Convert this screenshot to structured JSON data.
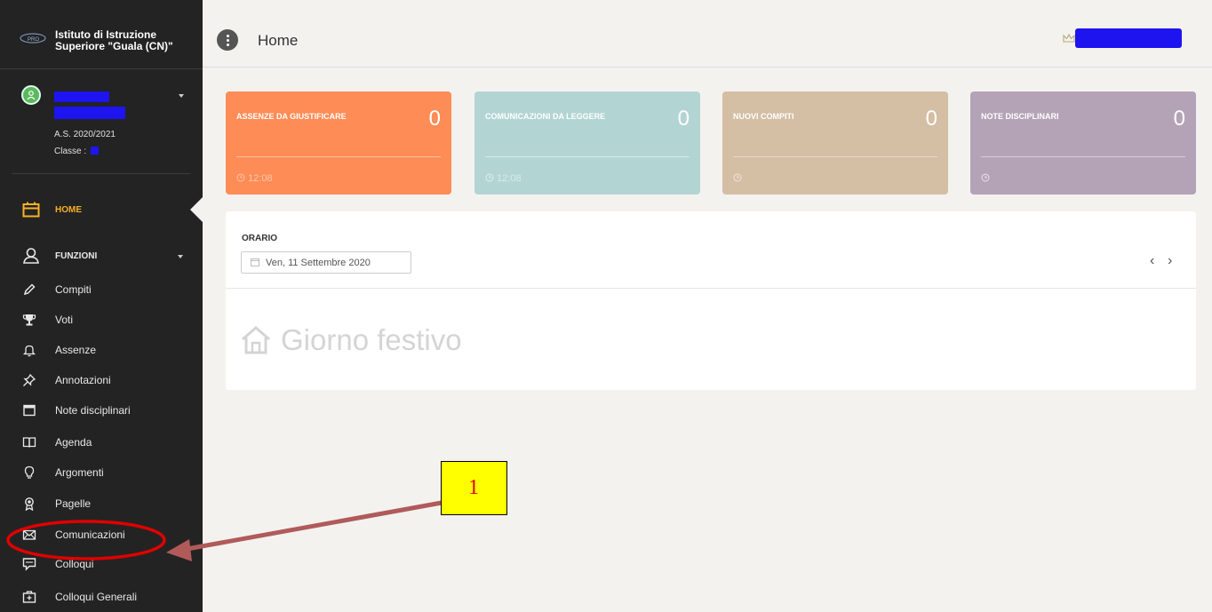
{
  "school": {
    "name": "Istituto di Istruzione Superiore \"Guala (CN)\"",
    "logo_icon": "school-logo-icon"
  },
  "user": {
    "school_year": "A.S. 2020/2021",
    "class_label": "Classe :",
    "avatar_icon": "user-avatar-icon"
  },
  "sidebar": {
    "home": {
      "label": "HOME",
      "icon": "calendar-icon",
      "active_color": "#f6b026"
    },
    "functions": {
      "label": "FUNZIONI",
      "icon": "person-icon"
    },
    "items": [
      {
        "label": "Compiti",
        "icon": "pencil-icon"
      },
      {
        "label": "Voti",
        "icon": "trophy-icon"
      },
      {
        "label": "Assenze",
        "icon": "bell-icon"
      },
      {
        "label": "Annotazioni",
        "icon": "pin-icon"
      },
      {
        "label": "Note disciplinari",
        "icon": "window-icon"
      },
      {
        "label": "Agenda",
        "icon": "book-icon"
      },
      {
        "label": "Argomenti",
        "icon": "lightbulb-icon"
      },
      {
        "label": "Pagelle",
        "icon": "award-icon"
      },
      {
        "label": "Comunicazioni",
        "icon": "envelope-icon"
      },
      {
        "label": "Colloqui",
        "icon": "chat-icon"
      },
      {
        "label": "Colloqui Generali",
        "icon": "briefcase-icon"
      }
    ]
  },
  "header": {
    "title": "Home",
    "crown_icon": "crown-icon"
  },
  "cards": [
    {
      "title": "ASSENZE DA GIUSTIFICARE",
      "count": "0",
      "time": "12:08",
      "color": "#fe8c56"
    },
    {
      "title": "COMUNICAZIONI DA LEGGERE",
      "count": "0",
      "time": "12:08",
      "color": "#b2d5d3"
    },
    {
      "title": "NUOVI COMPITI",
      "count": "0",
      "time": "",
      "color": "#d4bea4"
    },
    {
      "title": "NOTE DISCIPLINARI",
      "count": "0",
      "time": "",
      "color": "#b4a3b6"
    }
  ],
  "schedule": {
    "label": "ORARIO",
    "date": "Ven, 11 Settembre 2020",
    "prev": "‹",
    "next": "›",
    "message": "Giorno festivo"
  },
  "annotation": {
    "number": "1",
    "box_color": "#ffff00",
    "highlight_color": "#e00000"
  }
}
